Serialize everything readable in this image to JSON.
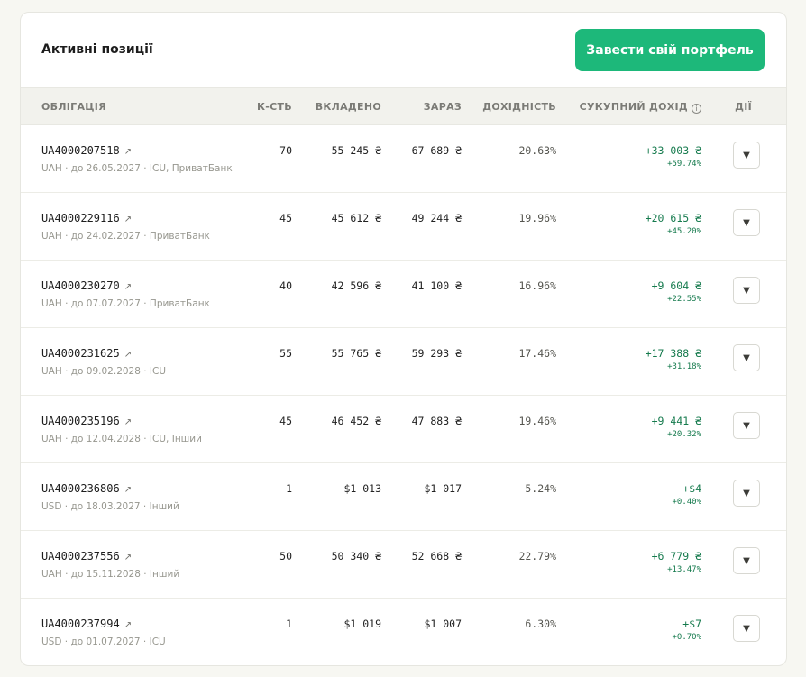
{
  "header": {
    "title": "Активні позиції",
    "cta_label": "Завести свій портфель"
  },
  "columns": {
    "bond": "ОБЛІГАЦІЯ",
    "qty": "К-СТЬ",
    "invested": "ВКЛАДЕНО",
    "now": "ЗАРАЗ",
    "yield": "ДОХІДНІСТЬ",
    "total": "СУКУПНИЙ ДОХІД",
    "actions": "ДІЇ",
    "info_glyph": "i"
  },
  "icons": {
    "external": "↗",
    "dropdown": "▼"
  },
  "colors": {
    "accent": "#1db87a",
    "positive": "#157a4d"
  },
  "rows": [
    {
      "code": "UA4000207518",
      "meta": "UAH · до 26.05.2027 · ICU, ПриватБанк",
      "qty": "70",
      "invested": "55 245 ₴",
      "now": "67 689 ₴",
      "yield": "20.63%",
      "total": "+33 003 ₴",
      "total_pct": "+59.74%"
    },
    {
      "code": "UA4000229116",
      "meta": "UAH · до 24.02.2027 · ПриватБанк",
      "qty": "45",
      "invested": "45 612 ₴",
      "now": "49 244 ₴",
      "yield": "19.96%",
      "total": "+20 615 ₴",
      "total_pct": "+45.20%"
    },
    {
      "code": "UA4000230270",
      "meta": "UAH · до 07.07.2027 · ПриватБанк",
      "qty": "40",
      "invested": "42 596 ₴",
      "now": "41 100 ₴",
      "yield": "16.96%",
      "total": "+9 604 ₴",
      "total_pct": "+22.55%"
    },
    {
      "code": "UA4000231625",
      "meta": "UAH · до 09.02.2028 · ICU",
      "qty": "55",
      "invested": "55 765 ₴",
      "now": "59 293 ₴",
      "yield": "17.46%",
      "total": "+17 388 ₴",
      "total_pct": "+31.18%"
    },
    {
      "code": "UA4000235196",
      "meta": "UAH · до 12.04.2028 · ICU, Інший",
      "qty": "45",
      "invested": "46 452 ₴",
      "now": "47 883 ₴",
      "yield": "19.46%",
      "total": "+9 441 ₴",
      "total_pct": "+20.32%"
    },
    {
      "code": "UA4000236806",
      "meta": "USD · до 18.03.2027 · Інший",
      "qty": "1",
      "invested": "$1 013",
      "now": "$1 017",
      "yield": "5.24%",
      "total": "+$4",
      "total_pct": "+0.40%"
    },
    {
      "code": "UA4000237556",
      "meta": "UAH · до 15.11.2028 · Інший",
      "qty": "50",
      "invested": "50 340 ₴",
      "now": "52 668 ₴",
      "yield": "22.79%",
      "total": "+6 779 ₴",
      "total_pct": "+13.47%"
    },
    {
      "code": "UA4000237994",
      "meta": "USD · до 01.07.2027 · ICU",
      "qty": "1",
      "invested": "$1 019",
      "now": "$1 007",
      "yield": "6.30%",
      "total": "+$7",
      "total_pct": "+0.70%"
    }
  ]
}
